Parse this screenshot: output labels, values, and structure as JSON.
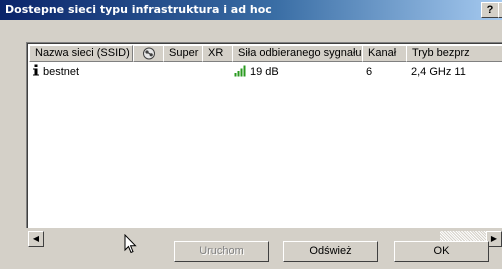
{
  "window": {
    "title": "Dostepne sieci typu infrastruktura i ad hoc",
    "help_button": "?",
    "close_button": "×"
  },
  "list": {
    "columns": [
      {
        "label": "Nazwa sieci (SSID)"
      },
      {
        "label": "",
        "icon": "wireless-security-icon"
      },
      {
        "label": "Super"
      },
      {
        "label": "XR"
      },
      {
        "label": "Siła odbieranego sygnału"
      },
      {
        "label": "Kanał"
      },
      {
        "label": "Tryb bezprz"
      }
    ],
    "rows": [
      {
        "type_icon": "info-icon",
        "ssid": "bestnet",
        "signal_icon": "signal-bars-icon",
        "signal": "19 dB",
        "channel": "6",
        "mode": "2,4 GHz 11"
      }
    ]
  },
  "scrollbar": {
    "left_arrow": "◀",
    "right_arrow": "▶"
  },
  "buttons": {
    "connect": "Uruchom",
    "refresh": "Odśwież",
    "ok": "OK"
  },
  "colors": {
    "title_start": "#0a246a",
    "title_end": "#a6caf0",
    "face": "#d4d0c8",
    "signal": "#2a9a1f"
  }
}
